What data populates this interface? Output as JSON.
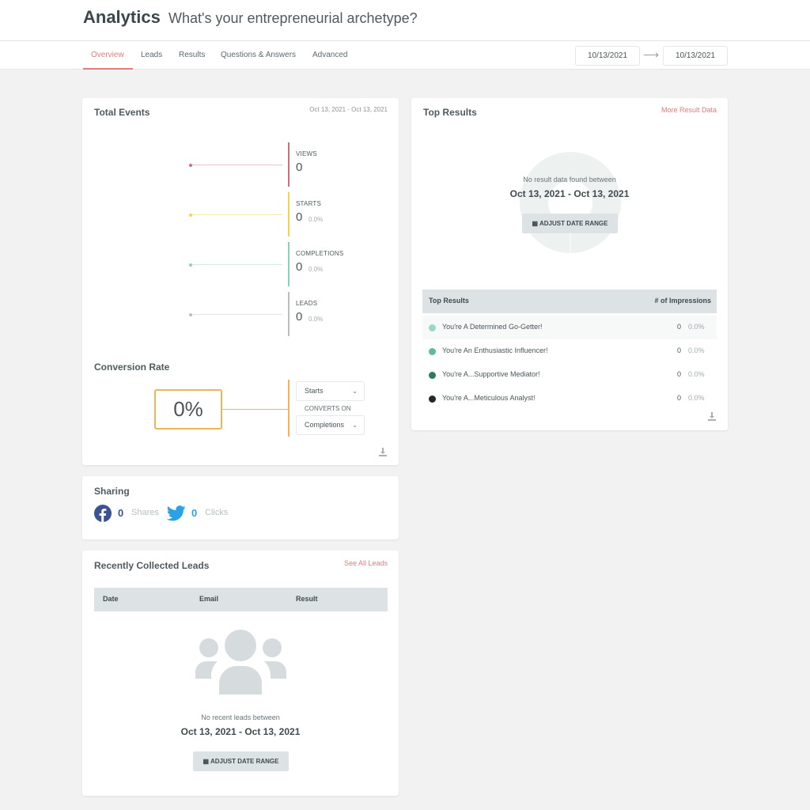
{
  "header": {
    "title": "Analytics",
    "subtitle": "What's your entrepreneurial archetype?"
  },
  "nav": {
    "tabs": [
      {
        "label": "Overview",
        "active": true
      },
      {
        "label": "Leads",
        "active": false
      },
      {
        "label": "Results",
        "active": false
      },
      {
        "label": "Questions & Answers",
        "active": false
      },
      {
        "label": "Advanced",
        "active": false
      }
    ],
    "date_from": "10/13/2021",
    "date_to": "10/13/2021",
    "arrow": "⟶"
  },
  "total_events": {
    "title": "Total Events",
    "range": "Oct 13, 2021 - Oct 13, 2021",
    "events": [
      {
        "label": "VIEWS",
        "value": "0",
        "pct": "",
        "color": "#c9707a"
      },
      {
        "label": "STARTS",
        "value": "0",
        "pct": "0.0%",
        "color": "#f2d34f"
      },
      {
        "label": "COMPLETIONS",
        "value": "0",
        "pct": "0.0%",
        "color": "#8ccfbf"
      },
      {
        "label": "LEADS",
        "value": "0",
        "pct": "0.0%",
        "color": "#b7bfc1"
      }
    ]
  },
  "conversion": {
    "title": "Conversion Rate",
    "value": "0%",
    "from_select": "Starts",
    "converts_on_label": "CONVERTS ON",
    "to_select": "Completions",
    "accent": "#f0b35a"
  },
  "sharing": {
    "title": "Sharing",
    "facebook_count": "0",
    "facebook_label": "Shares",
    "twitter_count": "0",
    "twitter_label": "Clicks"
  },
  "leads": {
    "title": "Recently Collected Leads",
    "link": "See All Leads",
    "columns": [
      "Date",
      "Email",
      "Result"
    ],
    "empty_message": "No recent leads between",
    "empty_range": "Oct 13, 2021 - Oct 13, 2021",
    "adjust_label": "ADJUST DATE RANGE"
  },
  "top_results": {
    "title": "Top Results",
    "link": "More Result Data",
    "empty_message": "No result data found between",
    "empty_range": "Oct 13, 2021 - Oct 13, 2021",
    "adjust_label": "ADJUST DATE RANGE",
    "table_header": "Top Results",
    "impressions_header": "# of Impressions",
    "rows": [
      {
        "name": "You're A Determined Go-Getter!",
        "count": "0",
        "pct": "0.0%",
        "color": "#9dd5c8"
      },
      {
        "name": "You're An Enthusiastic Influencer!",
        "count": "0",
        "pct": "0.0%",
        "color": "#5fb99a"
      },
      {
        "name": "You're A...Supportive Mediator!",
        "count": "0",
        "pct": "0.0%",
        "color": "#2f7a5f"
      },
      {
        "name": "You're A...Meticulous Analyst!",
        "count": "0",
        "pct": "0.0%",
        "color": "#1f2b28"
      }
    ]
  }
}
